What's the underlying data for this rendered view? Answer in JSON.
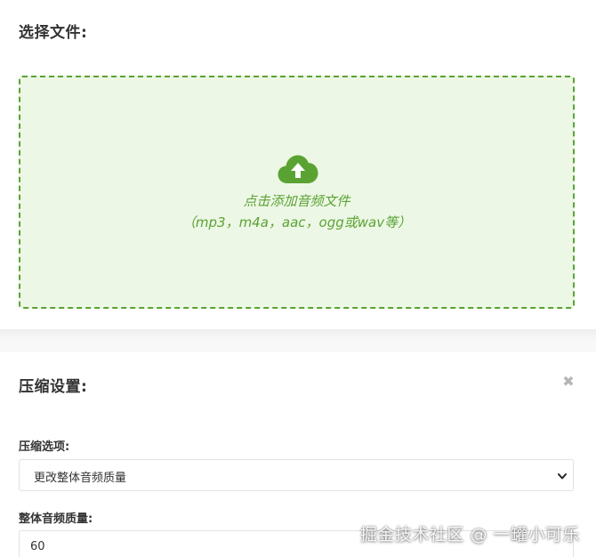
{
  "file_section": {
    "title": "选择文件:",
    "dropzone": {
      "line1": "点击添加音频文件",
      "line2": "（mp3，m4a，aac，ogg或wav等）",
      "icon": "cloud-upload-icon",
      "accent_color": "#5aa333",
      "background_color": "#edf7e6"
    }
  },
  "settings_section": {
    "title": "压缩设置:",
    "close_icon": "close-icon",
    "option_label": "压缩选项:",
    "option_selected": "更改整体音频质量",
    "quality_label": "整体音频质量:",
    "quality_value": "60"
  },
  "watermark": "掘金技术社区 @ 一罐小可乐"
}
